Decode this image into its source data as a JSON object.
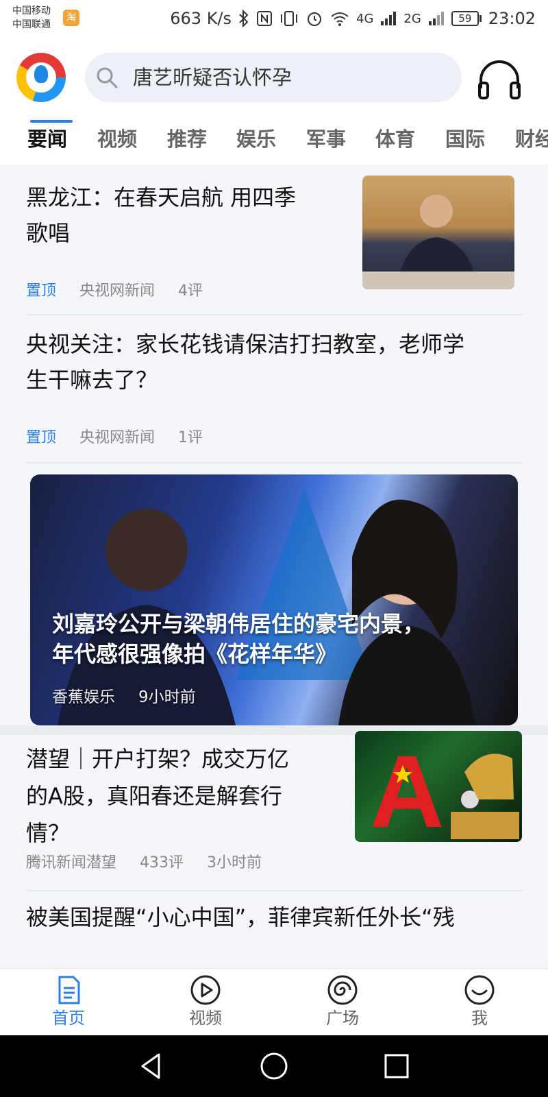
{
  "status_bar": {
    "carrier_1": "中国移动",
    "carrier_2": "中国联通",
    "carrier_badge": "淘",
    "speed": "663 K/s",
    "net_4g": "4G",
    "net_2g": "2G",
    "battery": "59",
    "time": "23:02"
  },
  "header": {
    "search_text": "唐艺昕疑否认怀孕",
    "tabs": [
      "要闻",
      "视频",
      "推荐",
      "娱乐",
      "军事",
      "体育",
      "国际",
      "财经"
    ],
    "active_tab": "要闻"
  },
  "feed": {
    "items": [
      {
        "title_line1": "黑龙江：在春天启航 用四季",
        "title_line2": "歌唱",
        "pin": "置顶",
        "source": "央视网新闻",
        "comments": "4评",
        "thumb_icon": "news-photo"
      },
      {
        "title_line1": "央视关注：家长花钱请保洁打扫教室，老师学",
        "title_line2": "生干嘛去了？",
        "pin": "置顶",
        "source": "央视网新闻",
        "comments": "1评"
      },
      {
        "title_line1": "潜望｜开户打架？成交万亿",
        "title_line2": "的A股，真阳春还是解套行",
        "title_line3": "情？",
        "source": "腾讯新闻潜望",
        "comments": "433评",
        "time": "3小时前"
      },
      {
        "title_line1": "被美国提醒“小心中国”，菲律宾新任外长“残"
      }
    ],
    "banner": {
      "title_line1": "刘嘉玲公开与梁朝伟居住的豪宅内景，",
      "title_line2": "年代感很强像拍《花样年华》",
      "source": "香蕉娱乐",
      "time": "9小时前"
    }
  },
  "bottom_nav": {
    "items": [
      {
        "label": "首页",
        "icon": "document-icon",
        "active": true
      },
      {
        "label": "视频",
        "icon": "play-icon"
      },
      {
        "label": "广场",
        "icon": "spiral-icon"
      },
      {
        "label": "我",
        "icon": "smile-icon"
      }
    ]
  },
  "colors": {
    "accent": "#2b7de9",
    "background": "#f4f6f9",
    "system_nav": "#000000"
  }
}
